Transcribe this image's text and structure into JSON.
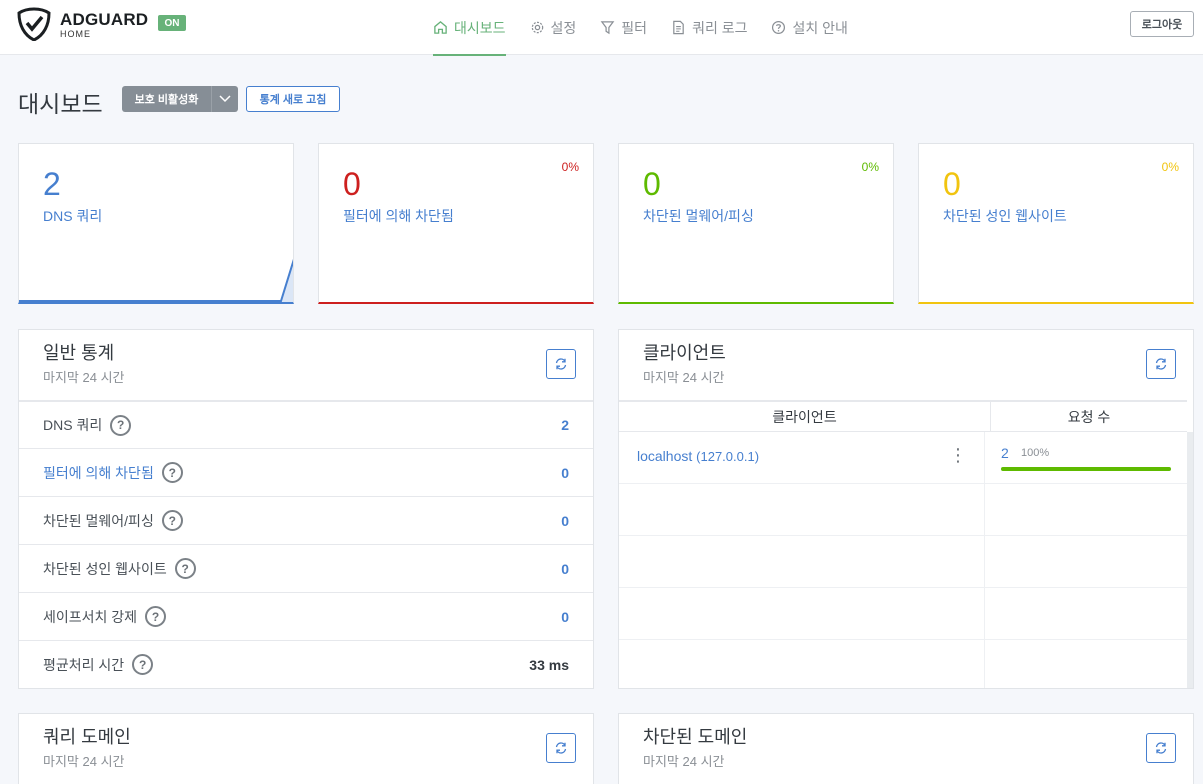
{
  "header": {
    "brand": "ADGUARD",
    "brand_sub": "HOME",
    "status_badge": "ON",
    "nav": [
      {
        "label": "대시보드",
        "icon": "home-icon",
        "active": true
      },
      {
        "label": "설정",
        "icon": "gear-icon",
        "active": false
      },
      {
        "label": "필터",
        "icon": "filter-icon",
        "active": false
      },
      {
        "label": "쿼리 로그",
        "icon": "document-icon",
        "active": false
      },
      {
        "label": "설치 안내",
        "icon": "help-circle-icon",
        "active": false
      }
    ],
    "logout_label": "로그아웃"
  },
  "page": {
    "title": "대시보드",
    "protection_button": "보호 비활성화",
    "refresh_stats_button": "통계 새로 고침"
  },
  "stat_cards": [
    {
      "value": "2",
      "label": "DNS 쿼리",
      "percent": "",
      "color": "#467fcf"
    },
    {
      "value": "0",
      "label": "필터에 의해 차단됨",
      "percent": "0%",
      "color": "#cd201f"
    },
    {
      "value": "0",
      "label": "차단된 멀웨어/피싱",
      "percent": "0%",
      "color": "#5eba00"
    },
    {
      "value": "0",
      "label": "차단된 성인 웹사이트",
      "percent": "0%",
      "color": "#f1c40f"
    }
  ],
  "general_stats": {
    "title": "일반 통계",
    "subtitle": "마지막 24 시간",
    "rows": [
      {
        "name": "DNS 쿼리",
        "value": "2"
      },
      {
        "name": "필터에 의해 차단됨",
        "value": "0"
      },
      {
        "name": "차단된 멀웨어/피싱",
        "value": "0"
      },
      {
        "name": "차단된 성인 웹사이트",
        "value": "0"
      },
      {
        "name": "세이프서치 강제",
        "value": "0"
      },
      {
        "name": "평균처리 시간",
        "value": "33 ms"
      }
    ],
    "help_glyph": "?"
  },
  "clients": {
    "title": "클라이언트",
    "subtitle": "마지막 24 시간",
    "col_client": "클라이언트",
    "col_requests": "요청 수",
    "rows": [
      {
        "name": "localhost",
        "ip": "(127.0.0.1)",
        "count": "2",
        "percent_text": "100%",
        "percent": 100
      }
    ],
    "kebab": "⋮"
  },
  "top_queried": {
    "title": "쿼리 도메인",
    "subtitle": "마지막 24 시간"
  },
  "top_blocked": {
    "title": "차단된 도메인",
    "subtitle": "마지막 24 시간"
  }
}
